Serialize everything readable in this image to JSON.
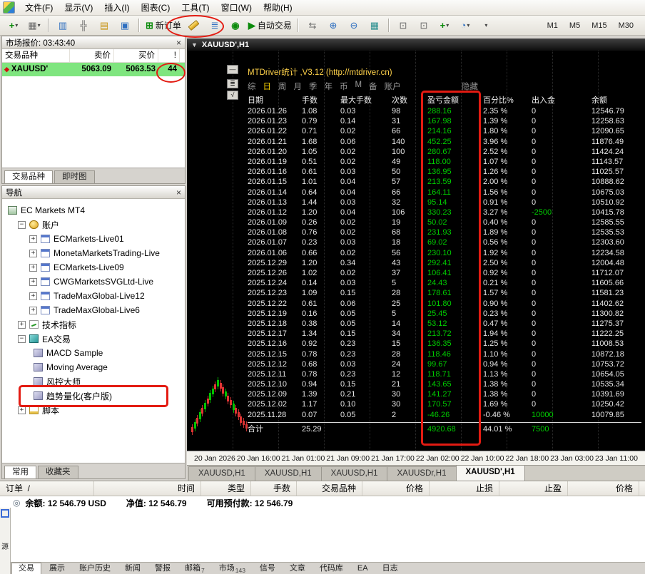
{
  "window": {
    "menu_items": [
      "文件(F)",
      "显示(V)",
      "插入(I)",
      "图表(C)",
      "工具(T)",
      "窗口(W)",
      "帮助(H)"
    ]
  },
  "toolbar": {
    "new_order_label": "新订单",
    "auto_trading_label": "自动交易",
    "periods": [
      "M1",
      "M5",
      "M15",
      "M30"
    ]
  },
  "market_watch": {
    "title": "市场报价: 03:43:40",
    "columns": [
      "交易品种",
      "卖价",
      "买价",
      "!"
    ],
    "row": {
      "symbol": "XAUUSD'",
      "bid": "5063.09",
      "ask": "5063.53",
      "spread": "44"
    },
    "tabs": [
      "交易品种",
      "即时图"
    ]
  },
  "navigator": {
    "title": "导航",
    "root": "EC Markets MT4",
    "accounts_label": "账户",
    "accounts": [
      "ECMarkets-Live01",
      "MonetaMarketsTrading-Live",
      "ECMarkets-Live09",
      "CWGMarketsSVGLtd-Live",
      "TradeMaxGlobal-Live12",
      "TradeMaxGlobal-Live6"
    ],
    "indicators_label": "技术指标",
    "ea_label": "EA交易",
    "ea_items": [
      "MACD Sample",
      "Moving Average",
      "风控大师",
      "趋势量化(客户版)"
    ],
    "scripts_label": "脚本",
    "tabs": [
      "常用",
      "收藏夹"
    ]
  },
  "chart": {
    "title": "XAUUSD',H1",
    "panel": {
      "header": "MTDriver统计 ,V3.12 (http://mtdriver.cn)",
      "tabs": [
        "综",
        "日",
        "周",
        "月",
        "季",
        "年",
        "币",
        "M",
        "备",
        "账户"
      ],
      "active_tab": "日",
      "hide_label": "隐藏",
      "columns": [
        "日期",
        "手数",
        "最大手数",
        "次数",
        "盈亏金额",
        "百分比%",
        "出入金",
        "余额"
      ],
      "rows": [
        [
          "2026.01.26",
          "1.08",
          "0.03",
          "98",
          "288.16",
          "2.35 %",
          "0",
          "12546.79"
        ],
        [
          "2026.01.23",
          "0.79",
          "0.14",
          "31",
          "167.98",
          "1.39 %",
          "0",
          "12258.63"
        ],
        [
          "2026.01.22",
          "0.71",
          "0.02",
          "66",
          "214.16",
          "1.80 %",
          "0",
          "12090.65"
        ],
        [
          "2026.01.21",
          "1.68",
          "0.06",
          "140",
          "452.25",
          "3.96 %",
          "0",
          "11876.49"
        ],
        [
          "2026.01.20",
          "1.05",
          "0.02",
          "100",
          "280.67",
          "2.52 %",
          "0",
          "11424.24"
        ],
        [
          "2026.01.19",
          "0.51",
          "0.02",
          "49",
          "118.00",
          "1.07 %",
          "0",
          "11143.57"
        ],
        [
          "2026.01.16",
          "0.61",
          "0.03",
          "50",
          "136.95",
          "1.26 %",
          "0",
          "11025.57"
        ],
        [
          "2026.01.15",
          "1.01",
          "0.04",
          "57",
          "213.59",
          "2.00 %",
          "0",
          "10888.62"
        ],
        [
          "2026.01.14",
          "0.64",
          "0.04",
          "66",
          "164.11",
          "1.56 %",
          "0",
          "10675.03"
        ],
        [
          "2026.01.13",
          "1.44",
          "0.03",
          "32",
          "95.14",
          "0.91 %",
          "0",
          "10510.92"
        ],
        [
          "2026.01.12",
          "1.20",
          "0.04",
          "106",
          "330.23",
          "3.27 %",
          "-2500",
          "10415.78"
        ],
        [
          "2026.01.09",
          "0.26",
          "0.02",
          "19",
          "50.02",
          "0.40 %",
          "0",
          "12585.55"
        ],
        [
          "2026.01.08",
          "0.76",
          "0.02",
          "68",
          "231.93",
          "1.89 %",
          "0",
          "12535.53"
        ],
        [
          "2026.01.07",
          "0.23",
          "0.03",
          "18",
          "69.02",
          "0.56 %",
          "0",
          "12303.60"
        ],
        [
          "2026.01.06",
          "0.66",
          "0.02",
          "56",
          "230.10",
          "1.92 %",
          "0",
          "12234.58"
        ],
        [
          "2025.12.29",
          "1.20",
          "0.34",
          "43",
          "292.41",
          "2.50 %",
          "0",
          "12004.48"
        ],
        [
          "2025.12.26",
          "1.02",
          "0.02",
          "37",
          "106.41",
          "0.92 %",
          "0",
          "11712.07"
        ],
        [
          "2025.12.24",
          "0.14",
          "0.03",
          "5",
          "24.43",
          "0.21 %",
          "0",
          "11605.66"
        ],
        [
          "2025.12.23",
          "1.09",
          "0.15",
          "28",
          "178.61",
          "1.57 %",
          "0",
          "11581.23"
        ],
        [
          "2025.12.22",
          "0.61",
          "0.06",
          "25",
          "101.80",
          "0.90 %",
          "0",
          "11402.62"
        ],
        [
          "2025.12.19",
          "0.16",
          "0.05",
          "5",
          "25.45",
          "0.23 %",
          "0",
          "11300.82"
        ],
        [
          "2025.12.18",
          "0.38",
          "0.05",
          "14",
          "53.12",
          "0.47 %",
          "0",
          "11275.37"
        ],
        [
          "2025.12.17",
          "1.34",
          "0.15",
          "34",
          "213.72",
          "1.94 %",
          "0",
          "11222.25"
        ],
        [
          "2025.12.16",
          "0.92",
          "0.23",
          "15",
          "136.35",
          "1.25 %",
          "0",
          "11008.53"
        ],
        [
          "2025.12.15",
          "0.78",
          "0.23",
          "28",
          "118.46",
          "1.10 %",
          "0",
          "10872.18"
        ],
        [
          "2025.12.12",
          "0.68",
          "0.03",
          "24",
          "99.67",
          "0.94 %",
          "0",
          "10753.72"
        ],
        [
          "2025.12.11",
          "0.78",
          "0.23",
          "12",
          "118.71",
          "1.13 %",
          "0",
          "10654.05"
        ],
        [
          "2025.12.10",
          "0.94",
          "0.15",
          "21",
          "143.65",
          "1.38 %",
          "0",
          "10535.34"
        ],
        [
          "2025.12.09",
          "1.39",
          "0.21",
          "30",
          "141.27",
          "1.38 %",
          "0",
          "10391.69"
        ],
        [
          "2025.12.02",
          "1.17",
          "0.10",
          "30",
          "170.57",
          "1.69 %",
          "0",
          "10250.42"
        ],
        [
          "2025.11.28",
          "0.07",
          "0.05",
          "2",
          "-46.26",
          "-0.46 %",
          "10000",
          "10079.85"
        ]
      ],
      "total_row": [
        "合计",
        "25.29",
        "",
        "",
        "4920.68",
        "44.01 %",
        "7500",
        ""
      ]
    },
    "time_axis": [
      "20 Jan 2026",
      "20 Jan 16:00",
      "21 Jan 01:00",
      "21 Jan 09:00",
      "21 Jan 17:00",
      "22 Jan 02:00",
      "22 Jan 10:00",
      "22 Jan 18:00",
      "23 Jan 03:00",
      "23 Jan 11:00"
    ],
    "window_tabs": [
      "XAUUSD,H1",
      "XAUUSD,H1",
      "XAUUSD,H1",
      "XAUUSDr,H1",
      "XAUUSD',H1"
    ],
    "active_window_tab": 4
  },
  "terminal": {
    "columns": [
      "订单  /",
      "时间",
      "类型",
      "手数",
      "交易品种",
      "价格",
      "止损",
      "止盈",
      "价格"
    ],
    "balance": "余额: 12 546.79 USD",
    "equity": "净值: 12 546.79",
    "free_margin": "可用预付款: 12 546.79",
    "tabs": [
      {
        "label": "交易"
      },
      {
        "label": "展示"
      },
      {
        "label": "账户历史"
      },
      {
        "label": "新闻"
      },
      {
        "label": "警报"
      },
      {
        "label": "邮箱",
        "badge": "7"
      },
      {
        "label": "市场",
        "badge": "143"
      },
      {
        "label": "信号"
      },
      {
        "label": "文章"
      },
      {
        "label": "代码库"
      },
      {
        "label": "EA"
      },
      {
        "label": "日志"
      }
    ]
  },
  "dock": {
    "label": "源"
  },
  "colors": {
    "profit_green": "#00cd00",
    "annotation_red": "#e31b12",
    "marketwatch_up_green": "#7fe57f",
    "panel_header_yellow": "#ffd24a"
  },
  "candles": [
    [
      528,
      7,
      "d"
    ],
    [
      521,
      9,
      "u"
    ],
    [
      515,
      8,
      "d"
    ],
    [
      507,
      10,
      "u"
    ],
    [
      501,
      8,
      "d"
    ],
    [
      494,
      9,
      "u"
    ],
    [
      488,
      7,
      "d"
    ],
    [
      480,
      10,
      "u"
    ],
    [
      474,
      8,
      "u"
    ],
    [
      468,
      7,
      "d"
    ],
    [
      462,
      9,
      "u"
    ],
    [
      466,
      8,
      "d"
    ],
    [
      472,
      9,
      "d"
    ],
    [
      478,
      7,
      "u"
    ],
    [
      484,
      8,
      "d"
    ],
    [
      490,
      7,
      "d"
    ],
    [
      495,
      9,
      "u"
    ],
    [
      501,
      8,
      "d"
    ],
    [
      507,
      7,
      "d"
    ],
    [
      513,
      9,
      "d"
    ],
    [
      519,
      6,
      "d"
    ],
    [
      524,
      6,
      "d"
    ]
  ]
}
